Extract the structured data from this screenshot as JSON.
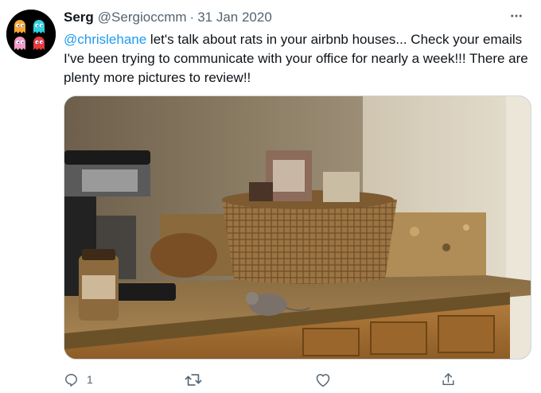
{
  "tweet": {
    "author_name": "Serg",
    "author_handle": "@Sergioccmm",
    "separator": "·",
    "date": "31 Jan 2020",
    "mention": "@chrislehane",
    "body": " let's talk about rats in your airbnb houses... Check your emails I've been trying to communicate with your office for nearly a week!!! There are plenty more pictures to review!!"
  },
  "actions": {
    "reply_count": "1",
    "retweet_count": "",
    "like_count": ""
  },
  "icons": {
    "more": "more-horizontal-icon",
    "reply": "reply-icon",
    "retweet": "retweet-icon",
    "like": "like-icon",
    "share": "share-icon"
  },
  "colors": {
    "accent": "#1d9bf0",
    "secondary_text": "#536471",
    "text": "#0f1419"
  }
}
